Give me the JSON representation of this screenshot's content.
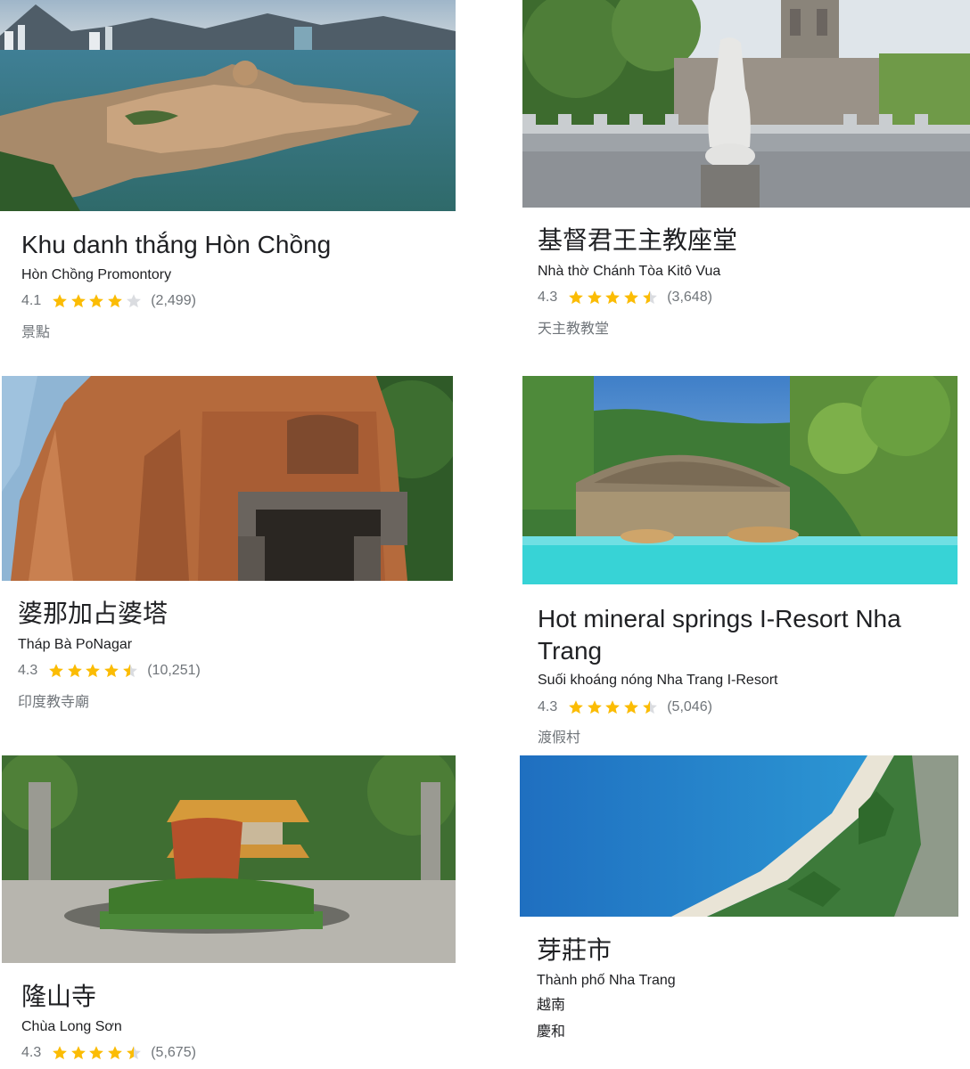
{
  "places": [
    {
      "title": "Khu danh thắng Hòn Chồng",
      "subtitle": "Hòn Chồng Promontory",
      "rating": "4.1",
      "stars": [
        1,
        1,
        1,
        1,
        0
      ],
      "reviews": "(2,499)",
      "category": "景點",
      "image_icon": "rocky-promontory-photo"
    },
    {
      "title": "基督君王主教座堂",
      "subtitle": "Nhà thờ Chánh Tòa Kitô Vua",
      "rating": "4.3",
      "stars": [
        1,
        1,
        1,
        1,
        0.5
      ],
      "reviews": "(3,648)",
      "category": "天主教教堂",
      "image_icon": "cathedral-statue-photo"
    },
    {
      "title": "婆那加占婆塔",
      "subtitle": "Tháp Bà PoNagar",
      "rating": "4.3",
      "stars": [
        1,
        1,
        1,
        1,
        0.5
      ],
      "reviews": "(10,251)",
      "category": "印度教寺廟",
      "image_icon": "brick-tower-photo"
    },
    {
      "title_line1": "Hot mineral springs I-Resort Nha",
      "title_line2": "Trang",
      "subtitle": "Suối khoáng nóng Nha Trang I-Resort",
      "rating": "4.3",
      "stars": [
        1,
        1,
        1,
        1,
        0.5
      ],
      "reviews": "(5,046)",
      "category": "渡假村",
      "image_icon": "hot-spring-pool-photo"
    },
    {
      "title": "隆山寺",
      "subtitle": "Chùa Long Sơn",
      "rating": "4.3",
      "stars": [
        1,
        1,
        1,
        1,
        0.5
      ],
      "reviews": "(5,675)",
      "image_icon": "pagoda-courtyard-photo"
    },
    {
      "title": "芽莊市",
      "subtitle": "Thành phố Nha Trang",
      "line1": "越南",
      "line2": "慶和",
      "image_icon": "coastline-beach-photo"
    }
  ],
  "colors": {
    "star_filled": "#fbbc04",
    "star_empty": "#dadce0",
    "secondary_text": "#70757a",
    "primary_text": "#202124"
  }
}
